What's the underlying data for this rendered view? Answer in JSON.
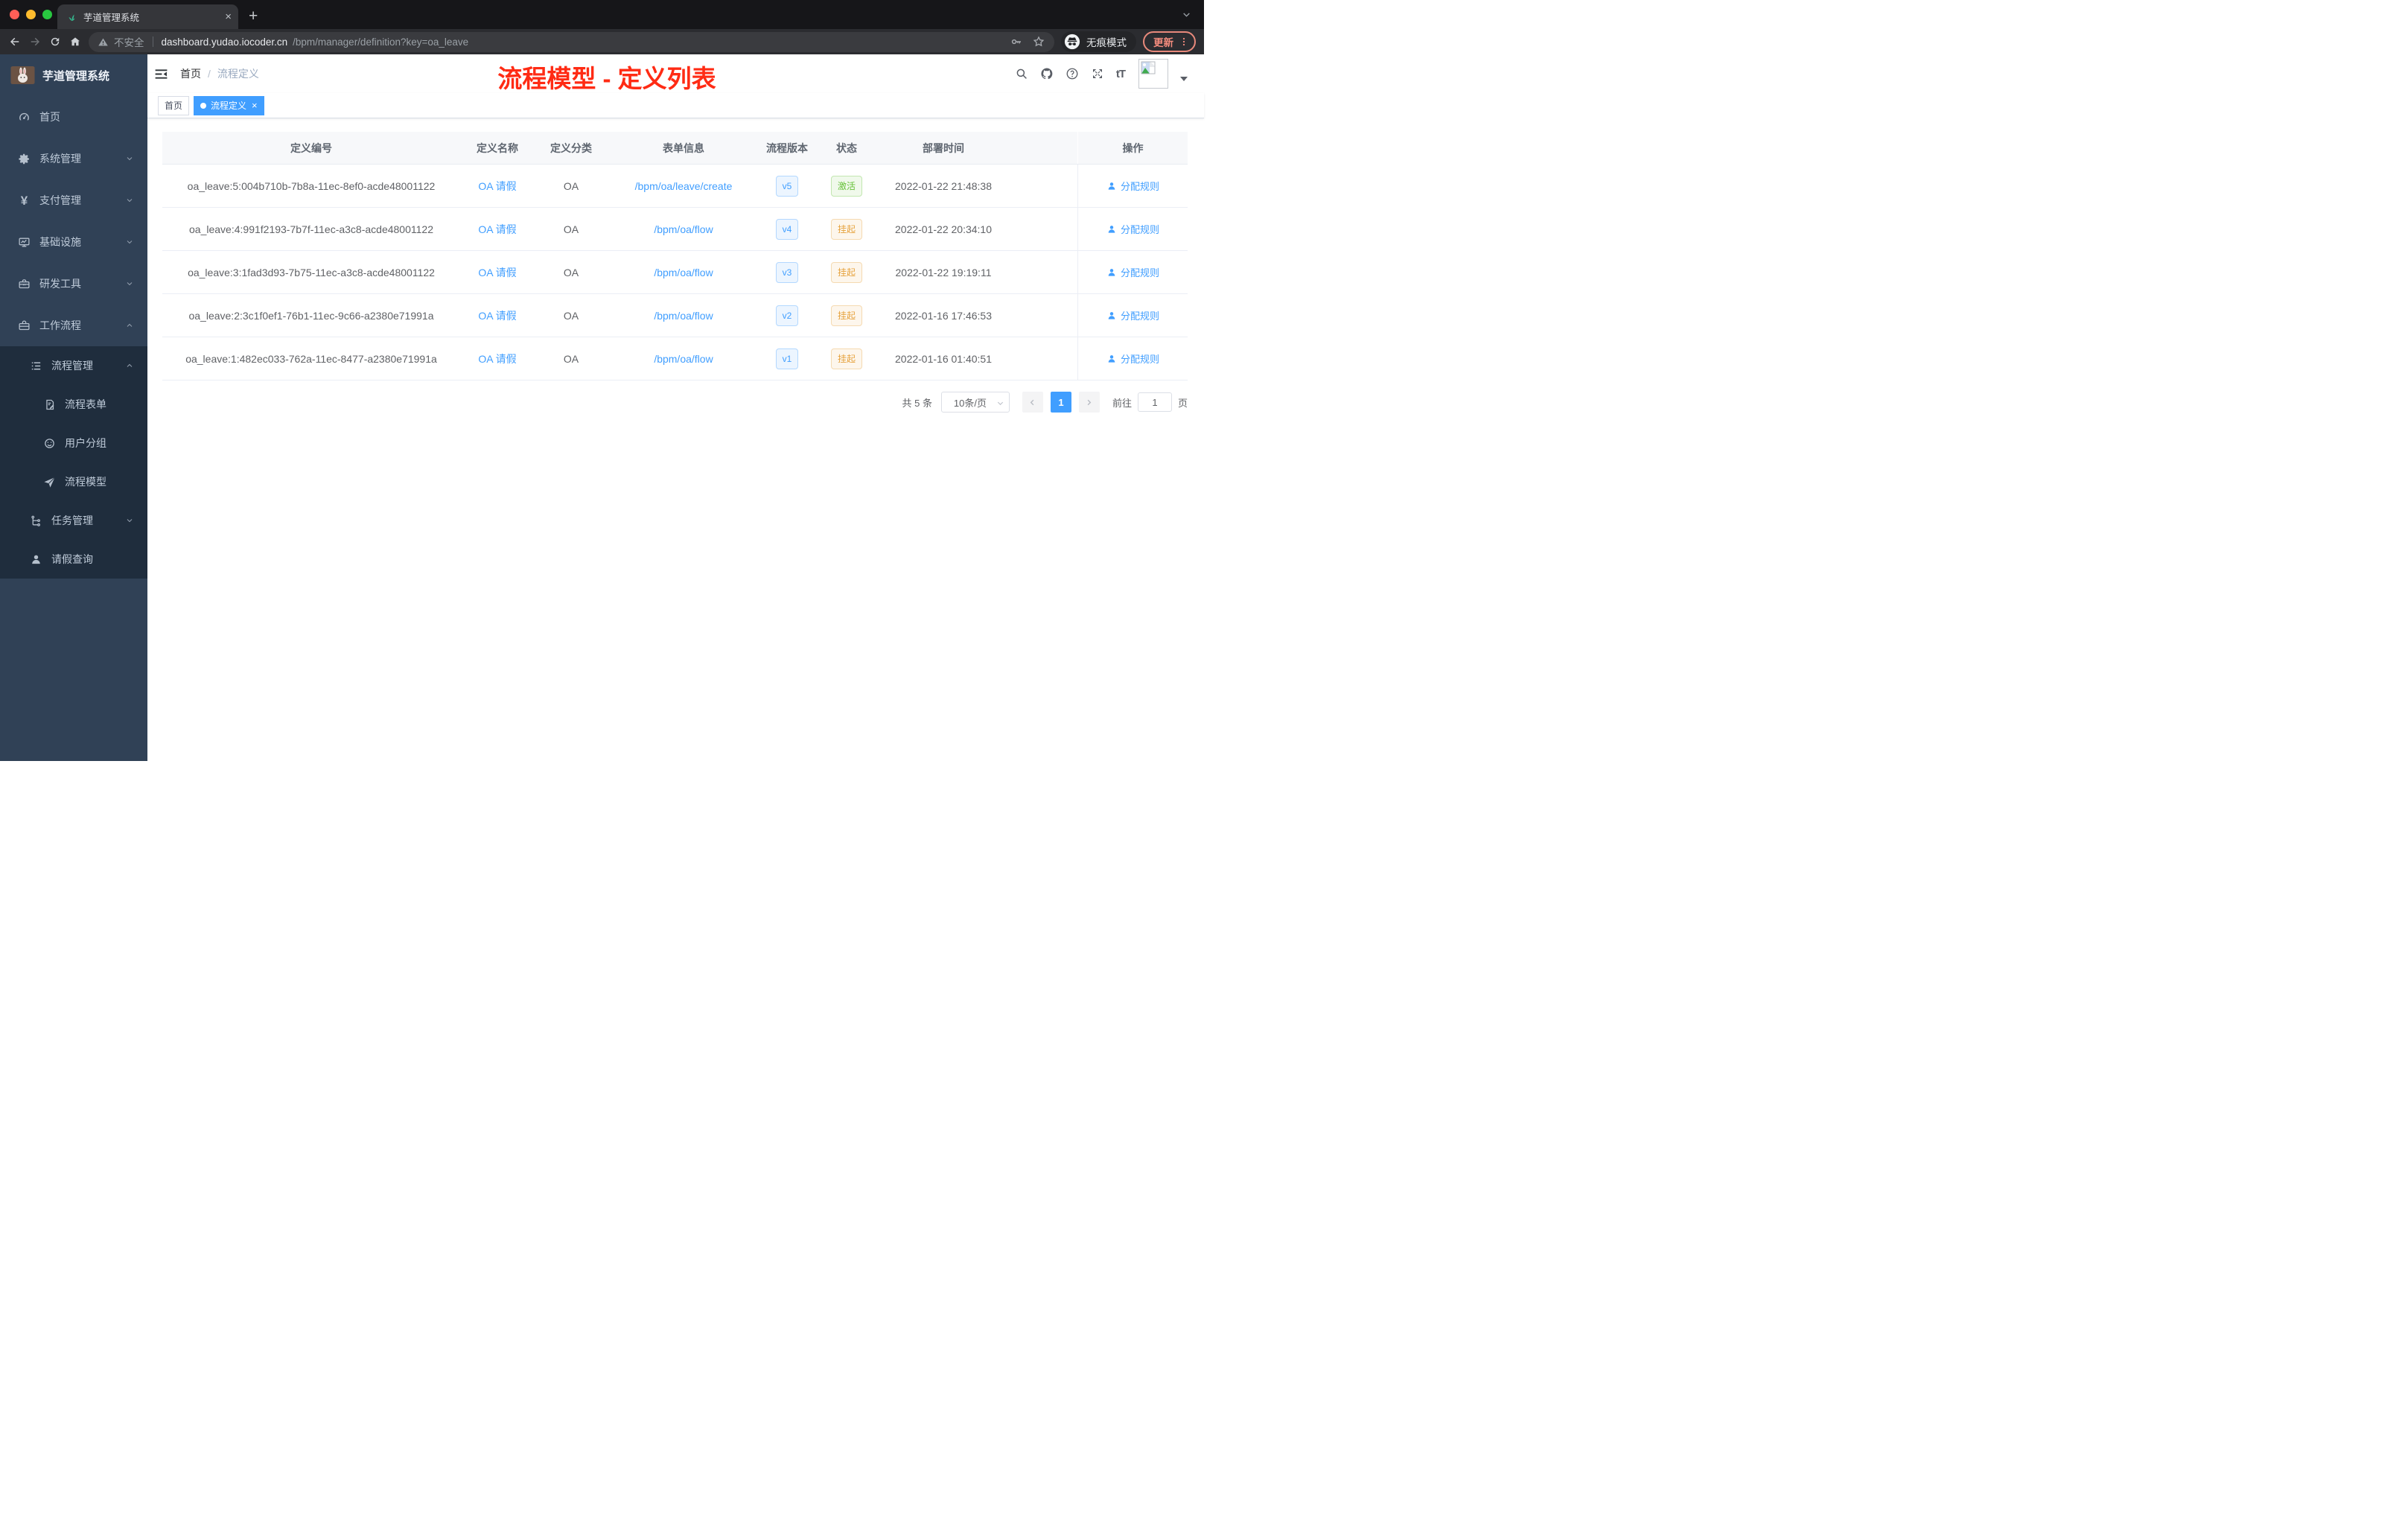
{
  "glyphs": {
    "plus": "+",
    "close": "×",
    "yen": "¥",
    "font_size": "tT"
  },
  "browser": {
    "tab_title": "芋道管理系统",
    "security_label": "不安全",
    "url_host": "dashboard.yudao.iocoder.cn",
    "url_path": "/bpm/manager/definition?key=oa_leave",
    "incognito_label": "无痕模式",
    "update_label": "更新"
  },
  "sidebar": {
    "logo_title": "芋道管理系统",
    "menu": [
      {
        "label": "首页",
        "icon": "dashboard-icon"
      },
      {
        "label": "系统管理",
        "icon": "gear-icon"
      },
      {
        "label": "支付管理",
        "icon": "yen-icon"
      },
      {
        "label": "基础设施",
        "icon": "monitor-icon"
      },
      {
        "label": "研发工具",
        "icon": "toolbox-icon"
      },
      {
        "label": "工作流程",
        "icon": "briefcase-icon"
      }
    ],
    "submenu": [
      {
        "label": "流程管理",
        "icon": "list-icon"
      },
      {
        "label": "流程表单",
        "icon": "form-icon"
      },
      {
        "label": "用户分组",
        "icon": "users-icon"
      },
      {
        "label": "流程模型",
        "icon": "paper-plane-icon"
      },
      {
        "label": "任务管理",
        "icon": "tree-icon"
      },
      {
        "label": "请假查询",
        "icon": "person-icon"
      }
    ]
  },
  "header": {
    "breadcrumb_home": "首页",
    "breadcrumb_separator": "/",
    "breadcrumb_current": "流程定义",
    "annotation_title": "流程模型 - 定义列表"
  },
  "tags": [
    {
      "label": "首页",
      "active": false
    },
    {
      "label": "流程定义",
      "active": true
    }
  ],
  "table": {
    "columns": [
      "定义编号",
      "定义名称",
      "定义分类",
      "表单信息",
      "流程版本",
      "状态",
      "部署时间",
      "操作"
    ],
    "rows": [
      {
        "id": "oa_leave:5:004b710b-7b8a-11ec-8ef0-acde48001122",
        "name": "OA 请假",
        "category": "OA",
        "form": "/bpm/oa/leave/create",
        "version": "v5",
        "status": "激活",
        "time": "2022-01-22 21:48:38",
        "action": "分配规则"
      },
      {
        "id": "oa_leave:4:991f2193-7b7f-11ec-a3c8-acde48001122",
        "name": "OA 请假",
        "category": "OA",
        "form": "/bpm/oa/flow",
        "version": "v4",
        "status": "挂起",
        "time": "2022-01-22 20:34:10",
        "action": "分配规则"
      },
      {
        "id": "oa_leave:3:1fad3d93-7b75-11ec-a3c8-acde48001122",
        "name": "OA 请假",
        "category": "OA",
        "form": "/bpm/oa/flow",
        "version": "v3",
        "status": "挂起",
        "time": "2022-01-22 19:19:11",
        "action": "分配规则"
      },
      {
        "id": "oa_leave:2:3c1f0ef1-76b1-11ec-9c66-a2380e71991a",
        "name": "OA 请假",
        "category": "OA",
        "form": "/bpm/oa/flow",
        "version": "v2",
        "status": "挂起",
        "time": "2022-01-16 17:46:53",
        "action": "分配规则"
      },
      {
        "id": "oa_leave:1:482ec033-762a-11ec-8477-a2380e71991a",
        "name": "OA 请假",
        "category": "OA",
        "form": "/bpm/oa/flow",
        "version": "v1",
        "status": "挂起",
        "time": "2022-01-16 01:40:51",
        "action": "分配规则"
      }
    ]
  },
  "pagination": {
    "total": "共 5 条",
    "page_size": "10条/页",
    "current_page": "1",
    "goto_label": "前往",
    "goto_value": "1",
    "page_unit": "页"
  },
  "colors": {
    "primary": "#409eff",
    "success": "#67c23a",
    "warning": "#e6a23c",
    "annotation_red": "#ff2b14",
    "sidebar_bg": "#304156",
    "submenu_bg": "#1f2d3d"
  }
}
